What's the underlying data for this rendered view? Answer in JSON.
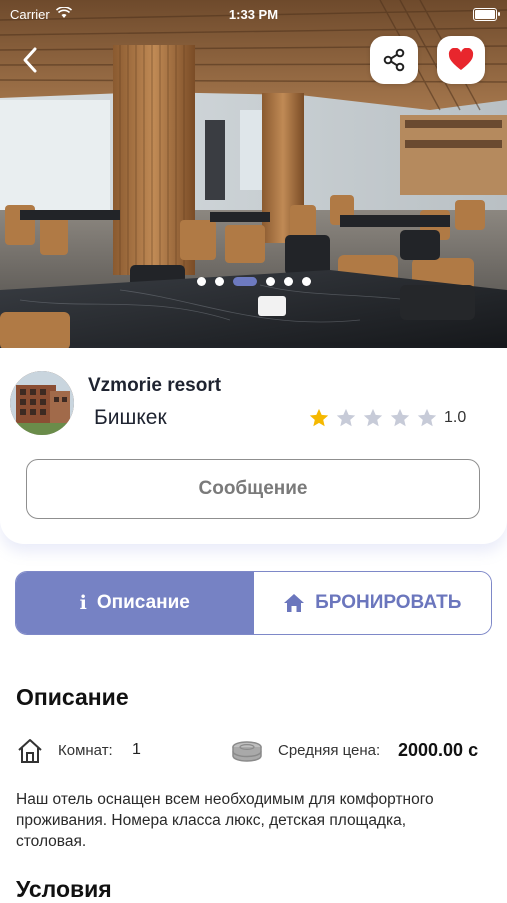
{
  "status_bar": {
    "carrier": "Carrier",
    "time": "1:33 PM"
  },
  "hero": {
    "slide_count": 6,
    "active_slide": 3
  },
  "hotel": {
    "name": "Vzmorie resort",
    "city": "Бишкек",
    "rating": "1.0",
    "rating_stars": 1,
    "max_stars": 5
  },
  "buttons": {
    "message": "Сообщение"
  },
  "tabs": {
    "description_icon": "i",
    "description": "Описание",
    "book": "БРОНИРОВАТЬ"
  },
  "description": {
    "title": "Описание",
    "rooms_label": "Комнат:",
    "rooms_value": "1",
    "price_label": "Средняя цена:",
    "price_value": "2000.00 с",
    "text": "Наш отель оснащен всем необходимым для комфортного проживания. Номера класса люкс, детская площадка, столовая."
  },
  "conditions": {
    "title": "Условия"
  },
  "colors": {
    "accent": "#7682c4",
    "star_filled": "#f5b800",
    "star_empty": "#c7cbd8",
    "favorite": "#e8262d"
  },
  "icons": {
    "back": "chevron-left-icon",
    "share": "share-icon",
    "favorite": "heart-icon",
    "book_tab": "home-icon",
    "rooms": "house-icon",
    "price": "coins-icon"
  }
}
